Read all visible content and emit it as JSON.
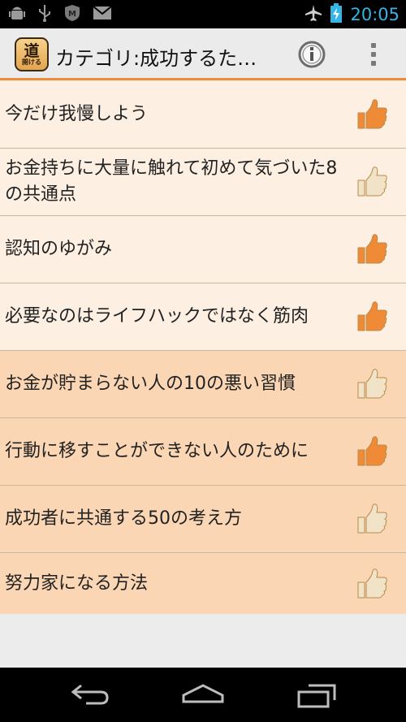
{
  "status_bar": {
    "time": "20:05",
    "left_icons": [
      "android-debug-icon",
      "usb-icon",
      "mcafee-icon",
      "gmail-icon"
    ],
    "right_icons": [
      "airplane-mode-icon",
      "battery-charging-icon"
    ]
  },
  "action_bar": {
    "app_icon_top": "道",
    "app_icon_bottom": "開ける",
    "title": "カテゴリ:成功するた…"
  },
  "items": [
    {
      "text": "今だけ我慢しよう",
      "liked": true
    },
    {
      "text": "お金持ちに大量に触れて初めて気づいた8の共通点",
      "liked": false
    },
    {
      "text": "認知のゆがみ",
      "liked": true
    },
    {
      "text": "必要なのはライフハックではなく筋肉",
      "liked": true
    },
    {
      "text": "お金が貯まらない人の10の悪い習慣",
      "liked": false
    },
    {
      "text": "行動に移すことができない人のために",
      "liked": true
    },
    {
      "text": "成功者に共通する50の考え方",
      "liked": false
    },
    {
      "text": "努力家になる方法",
      "liked": false
    }
  ],
  "colors": {
    "accent": "#ef8a36",
    "row_light": "#fdf0e3",
    "row_dark": "#fbd6b4",
    "thumb_on": "#ef8a36",
    "thumb_off": "#f1e3c7"
  }
}
